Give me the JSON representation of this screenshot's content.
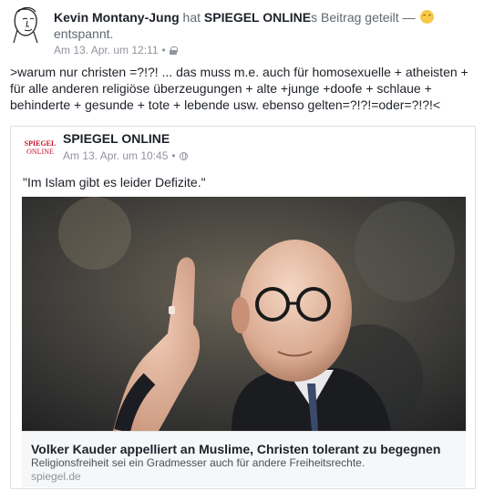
{
  "post": {
    "author": "Kevin Montany-Jung",
    "action_pre": " hat ",
    "shared_page": "SPIEGEL ONLINE",
    "action_post": "s Beitrag geteilt — ",
    "feeling": "entspannt.",
    "timestamp": "Am 13. Apr. um 12:11",
    "separator": "•",
    "privacy_icon": "lock-icon",
    "text": ">warum  nur christen =?!?! ... das muss  m.e. auch für homosexuelle + atheisten + für alle anderen religiöse überzeugungen + alte +junge +doofe + schlaue  + behinderte + gesunde + tote + lebende  usw. ebenso gelten=?!?!=oder=?!?!<"
  },
  "shared": {
    "logo_line1": "SPIEGEL",
    "logo_line2": "ONLINE",
    "page_name": "SPIEGEL ONLINE",
    "timestamp": "Am 13. Apr. um 10:45",
    "separator": "•",
    "privacy_icon": "globe-icon",
    "quote": "\"Im Islam gibt es leider Defizite.\"",
    "link": {
      "title": "Volker Kauder appelliert an Muslime, Christen tolerant zu begegnen",
      "description": "Religionsfreiheit sei ein Gradmesser auch für andere Freiheitsrechte.",
      "domain": "spiegel.de"
    }
  },
  "colors": {
    "brand_red": "#c8102e",
    "text": "#1d2129",
    "muted": "#90949c",
    "caption_bg": "#f6f7f9"
  }
}
